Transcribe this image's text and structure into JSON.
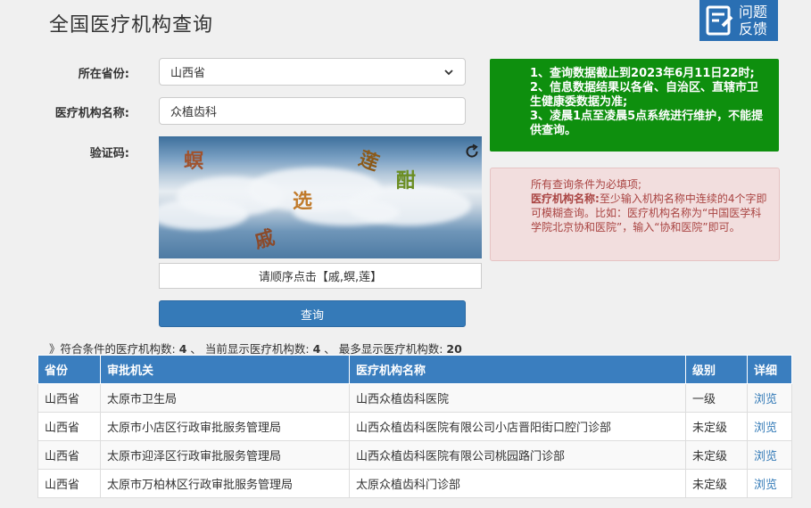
{
  "page": {
    "title": "全国医疗机构查询"
  },
  "feedback": {
    "line1": "问题",
    "line2": "反馈"
  },
  "form": {
    "province_label": "所在省份:",
    "province_value": "山西省",
    "name_label": "医疗机构名称:",
    "name_value": "众植齿科",
    "captcha_label": "验证码:",
    "captcha_chars": [
      "螟",
      "莲",
      "酣",
      "选",
      "戚"
    ],
    "captcha_hint": "请顺序点击【戚,螟,莲】",
    "query_button": "查询"
  },
  "notice_green": {
    "line1": "1、查询数据截止到2023年6月11日22时;",
    "line2": "2、信息数据结果以各省、自治区、直辖市卫生健康委数据为准;",
    "line3": "3、凌晨1点至凌晨5点系统进行维护，不能提供查询。"
  },
  "notice_pink": {
    "line1": "所有查询条件为必填项;",
    "bold": "医疗机构名称:",
    "text": "至少输入机构名称中连续的4个字即可模糊查询。比如：医疗机构名称为“中国医学科学院北京协和医院”，输入“协和医院”即可。"
  },
  "summary": {
    "prefix": "》符合条件的医疗机构数:",
    "total": "4",
    "mid1": "、 当前显示医疗机构数:",
    "shown": "4",
    "mid2": "、 最多显示医疗机构数:",
    "max": "20"
  },
  "table": {
    "headers": [
      "省份",
      "审批机关",
      "医疗机构名称",
      "级别",
      "详细"
    ],
    "rows": [
      [
        "山西省",
        "太原市卫生局",
        "山西众植齿科医院",
        "一级",
        "浏览"
      ],
      [
        "山西省",
        "太原市小店区行政审批服务管理局",
        "山西众植齿科医院有限公司小店晋阳街口腔门诊部",
        "未定级",
        "浏览"
      ],
      [
        "山西省",
        "太原市迎泽区行政审批服务管理局",
        "山西众植齿科医院有限公司桃园路门诊部",
        "未定级",
        "浏览"
      ],
      [
        "山西省",
        "太原市万柏林区行政审批服务管理局",
        "太原众植齿科门诊部",
        "未定级",
        "浏览"
      ]
    ]
  }
}
